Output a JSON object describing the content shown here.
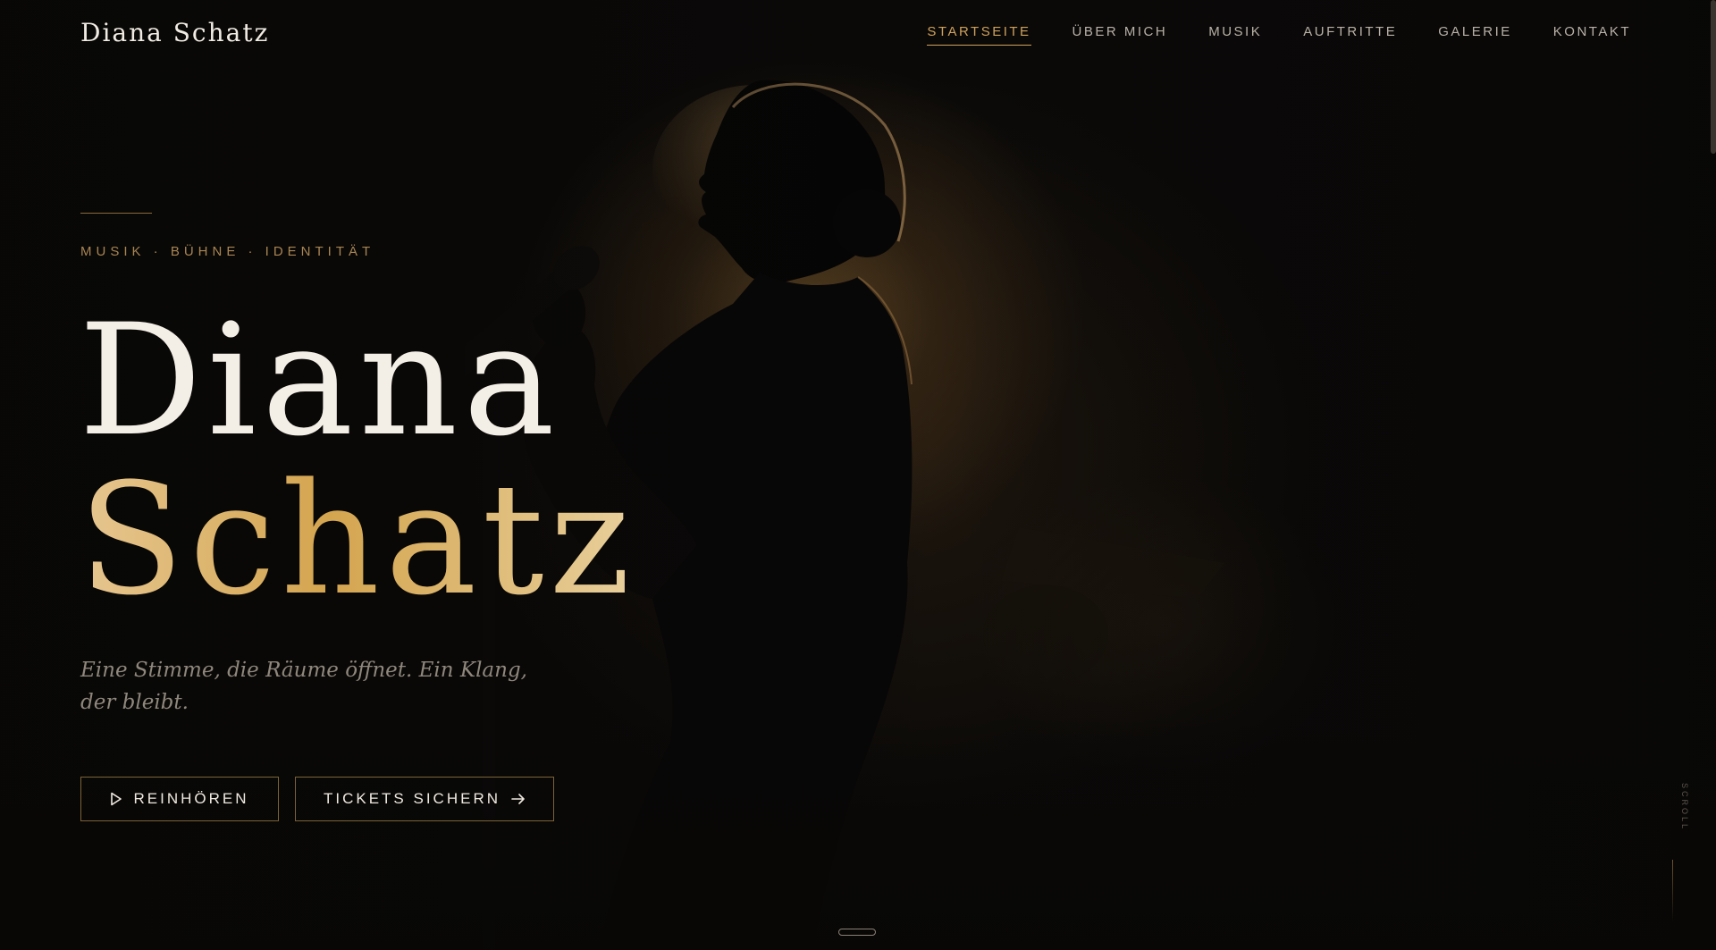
{
  "header": {
    "brand": "Diana Schatz",
    "nav": [
      {
        "label": "STARTSEITE",
        "active": true
      },
      {
        "label": "ÜBER MICH",
        "active": false
      },
      {
        "label": "MUSIK",
        "active": false
      },
      {
        "label": "AUFTRITTE",
        "active": false
      },
      {
        "label": "GALERIE",
        "active": false
      },
      {
        "label": "KONTAKT",
        "active": false
      }
    ]
  },
  "hero": {
    "eyebrow": "MUSIK · BÜHNE · IDENTITÄT",
    "name_first": "Diana",
    "name_last": "Schatz",
    "tagline": "Eine Stimme, die Räume öffnet. Ein Klang, der bleibt.",
    "buttons": {
      "listen": {
        "label": "REINHÖREN",
        "icon": "play-icon"
      },
      "tickets": {
        "label": "TICKETS SICHERN",
        "icon": "arrow-right-icon"
      }
    },
    "image": "singer-silhouette-with-microphone"
  },
  "scroll": {
    "label": "SCROLL"
  },
  "colors": {
    "accent": "#cfa15c",
    "background": "#0a0908",
    "text": "#f4efe6",
    "muted": "#8f877c"
  }
}
